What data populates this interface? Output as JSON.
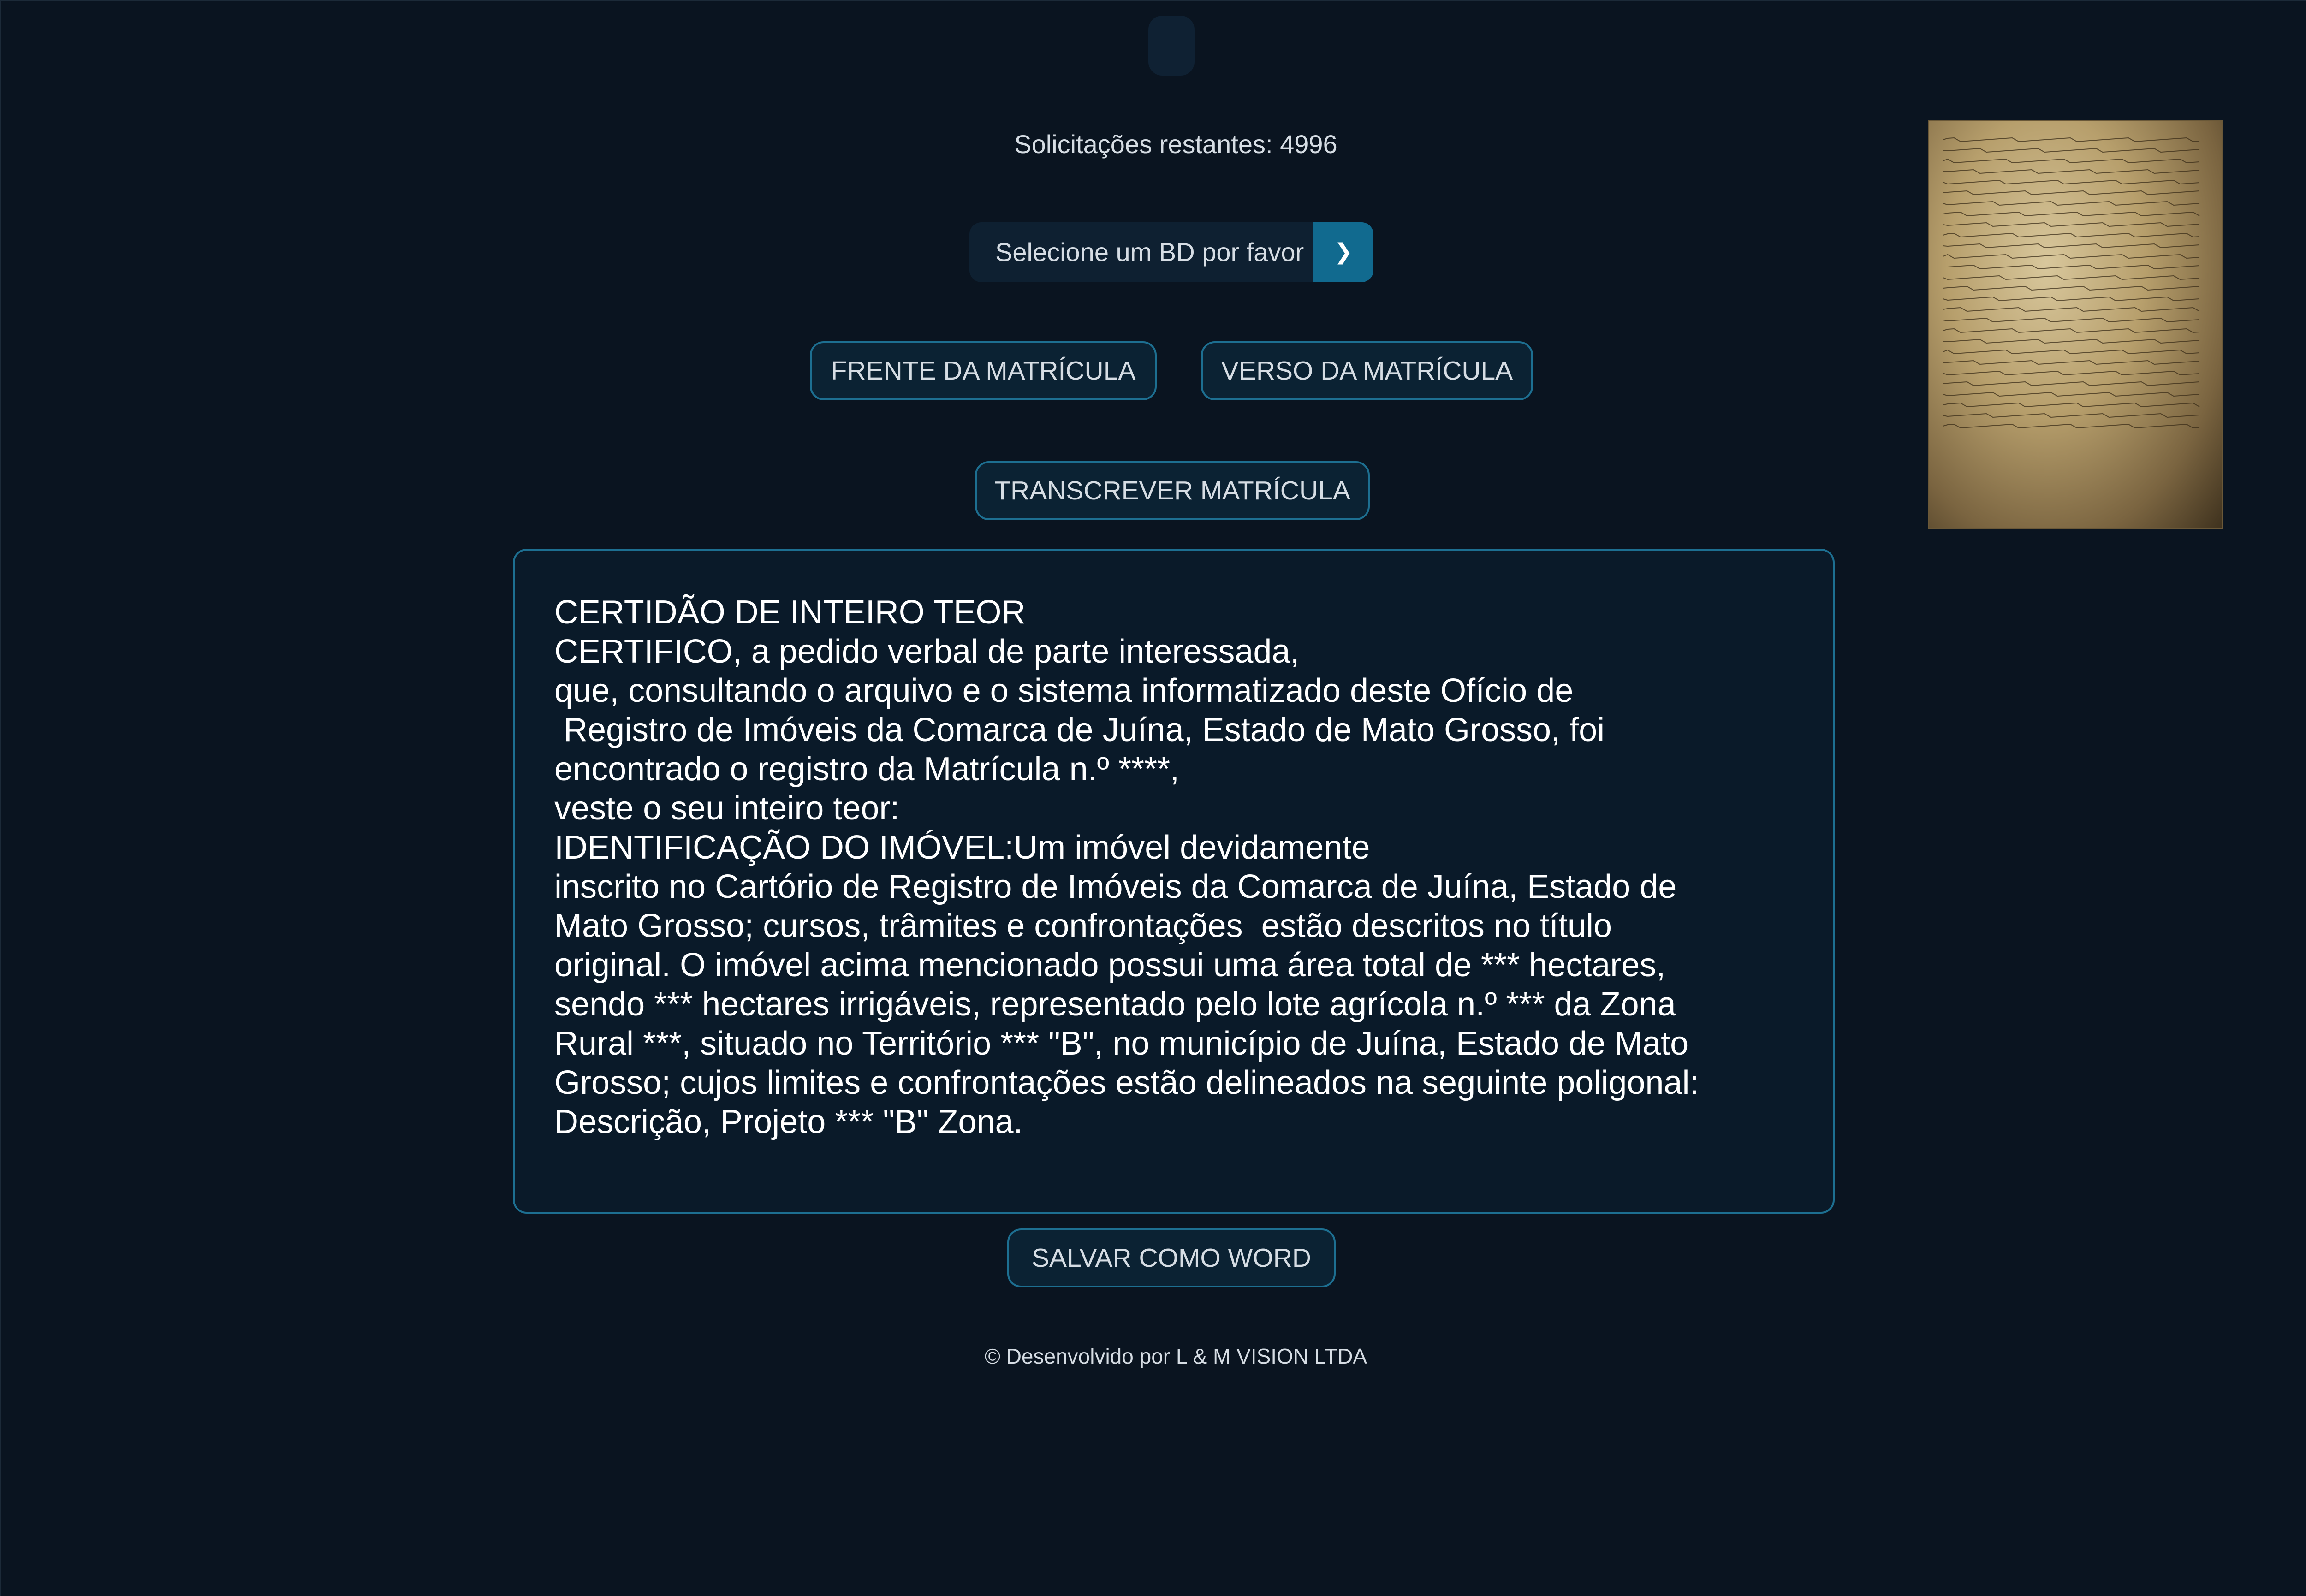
{
  "remaining": {
    "text": "Solicitações restantes: 4996"
  },
  "db_select": {
    "selected": "Selecione um BD por favor",
    "caret_icon": "chevron-down-icon"
  },
  "buttons": {
    "frente": "FRENTE DA MATRÍCULA",
    "verso": "VERSO DA MATRÍCULA",
    "transcrever": "TRANSCREVER MATRÍCULA",
    "salvar": "SALVAR COMO WORD"
  },
  "transcription": {
    "text": "CERTIDÃO DE INTEIRO TEOR\nCERTIFICO, a pedido verbal de parte interessada,\nque, consultando o arquivo e o sistema informatizado deste Ofício de\n Registro de Imóveis da Comarca de Juína, Estado de Mato Grosso, foi\nencontrado o registro da Matrícula n.º ****,\nveste o seu inteiro teor:\nIDENTIFICAÇÃO DO IMÓVEL:Um imóvel devidamente\ninscrito no Cartório de Registro de Imóveis da Comarca de Juína, Estado de\nMato Grosso; cursos, trâmites e confrontações  estão descritos no título\noriginal. O imóvel acima mencionado possui uma área total de *** hectares,\nsendo *** hectares irrigáveis, representado pelo lote agrícola n.º *** da Zona\nRural ***, situado no Território *** \"B\", no município de Juína, Estado de Mato\nGrosso; cujos limites e confrontações estão delineados na seguinte poligonal:\nDescrição, Projeto *** \"B\" Zona."
  },
  "footer": {
    "text": "© Desenvolvido por L & M VISION LTDA"
  },
  "thumbnail": {
    "icon": "handwritten-document-image"
  },
  "colors": {
    "background": "#0a1420",
    "accent": "#116a8f",
    "border": "#1d6f91",
    "text": "#ffffff"
  }
}
